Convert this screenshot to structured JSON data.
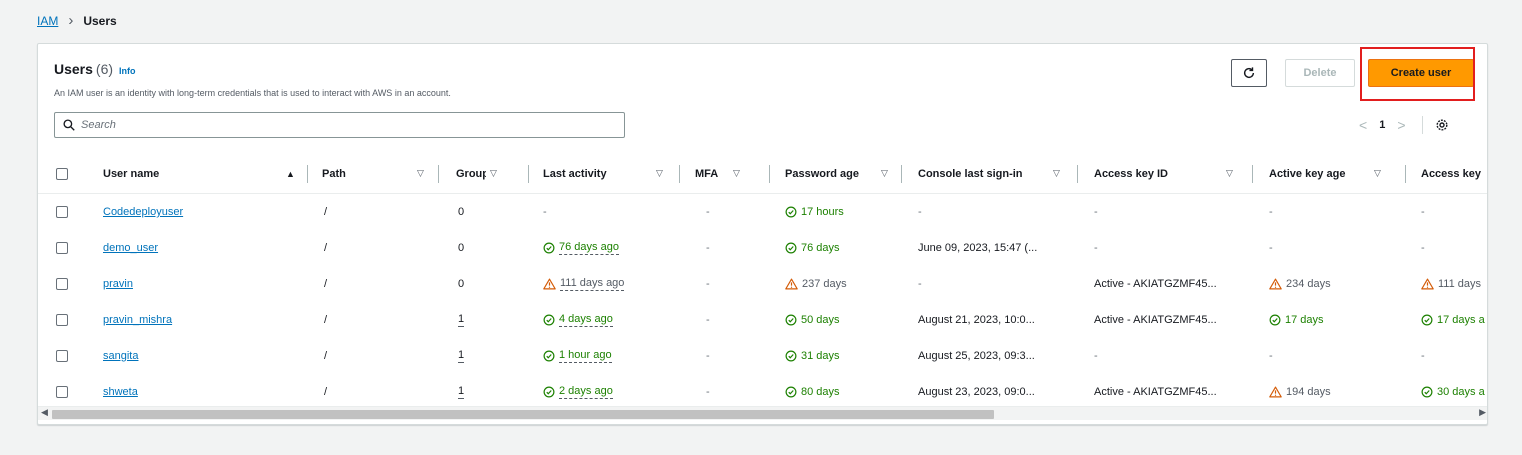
{
  "breadcrumb": {
    "root": "IAM",
    "separator": ">",
    "current": "Users"
  },
  "card": {
    "title": "Users",
    "count": "(6)",
    "info": "Info",
    "description": "An IAM user is an identity with long-term credentials that is used to interact with AWS in an account."
  },
  "actions": {
    "delete": "Delete",
    "create": "Create user"
  },
  "search": {
    "placeholder": "Search",
    "value": ""
  },
  "pagination": {
    "prev": "<",
    "page": "1",
    "next": ">"
  },
  "columns": [
    "User name",
    "Path",
    "Groups",
    "Last activity",
    "MFA",
    "Password age",
    "Console last sign-in",
    "Access key ID",
    "Active key age",
    "Access key"
  ],
  "sort": {
    "asc": "▲",
    "desc": "▽"
  },
  "rows": [
    {
      "user": "Codedeployuser",
      "path": "/",
      "groups": "0",
      "last_activity": "-",
      "last_activity_status": "none",
      "mfa": "-",
      "password_age": "17 hours",
      "password_status": "ok",
      "console_sign_in": "-",
      "access_key_id": "-",
      "active_key_age": "-",
      "active_key_status": "none",
      "access_key": "-",
      "access_key_status": "none"
    },
    {
      "user": "demo_user",
      "path": "/",
      "groups": "0",
      "last_activity": "76 days ago",
      "last_activity_status": "ok",
      "mfa": "-",
      "password_age": "76 days",
      "password_status": "ok",
      "console_sign_in": "June 09, 2023, 15:47 (...",
      "access_key_id": "-",
      "active_key_age": "-",
      "active_key_status": "none",
      "access_key": "-",
      "access_key_status": "none"
    },
    {
      "user": "pravin",
      "path": "/",
      "groups": "0",
      "last_activity": "111 days ago",
      "last_activity_status": "warn",
      "mfa": "-",
      "password_age": "237 days",
      "password_status": "warn",
      "console_sign_in": "-",
      "access_key_id": "Active - AKIATGZMF45...",
      "active_key_age": "234 days",
      "active_key_status": "warn",
      "access_key": "111 days",
      "access_key_status": "warn"
    },
    {
      "user": "pravin_mishra",
      "path": "/",
      "groups": "1",
      "last_activity": "4 days ago",
      "last_activity_status": "ok",
      "mfa": "-",
      "password_age": "50 days",
      "password_status": "ok",
      "console_sign_in": "August 21, 2023, 10:0...",
      "access_key_id": "Active - AKIATGZMF45...",
      "active_key_age": "17 days",
      "active_key_status": "ok",
      "access_key": "17 days a",
      "access_key_status": "ok"
    },
    {
      "user": "sangita",
      "path": "/",
      "groups": "1",
      "last_activity": "1 hour ago",
      "last_activity_status": "ok",
      "mfa": "-",
      "password_age": "31 days",
      "password_status": "ok",
      "console_sign_in": "August 25, 2023, 09:3...",
      "access_key_id": "-",
      "active_key_age": "-",
      "active_key_status": "none",
      "access_key": "-",
      "access_key_status": "none"
    },
    {
      "user": "shweta",
      "path": "/",
      "groups": "1",
      "last_activity": "2 days ago",
      "last_activity_status": "ok",
      "mfa": "-",
      "password_age": "80 days",
      "password_status": "ok",
      "console_sign_in": "August 23, 2023, 09:0...",
      "access_key_id": "Active - AKIATGZMF45...",
      "active_key_age": "194 days",
      "active_key_status": "warn",
      "access_key": "30 days a",
      "access_key_status": "ok"
    }
  ],
  "scrollbar": {
    "left": "◀",
    "right": "▶"
  },
  "colors": {
    "accent": "#ff9900",
    "link": "#0073bb",
    "ok": "#1d8102",
    "warn": "#d45b07",
    "highlight": "#e21e1e"
  },
  "icons": {
    "refresh": "refresh-icon",
    "search": "search-icon",
    "settings": "gear-icon",
    "ok": "check-circle-icon",
    "warn": "warning-icon"
  }
}
